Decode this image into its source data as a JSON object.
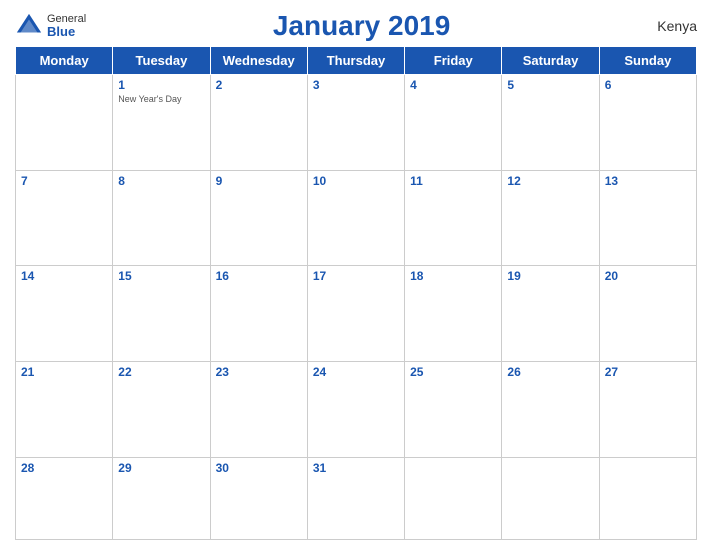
{
  "header": {
    "logo_general": "General",
    "logo_blue": "Blue",
    "title": "January 2019",
    "country": "Kenya"
  },
  "weekdays": [
    "Monday",
    "Tuesday",
    "Wednesday",
    "Thursday",
    "Friday",
    "Saturday",
    "Sunday"
  ],
  "weeks": [
    [
      {
        "day": "",
        "holiday": ""
      },
      {
        "day": "1",
        "holiday": "New Year's Day"
      },
      {
        "day": "2",
        "holiday": ""
      },
      {
        "day": "3",
        "holiday": ""
      },
      {
        "day": "4",
        "holiday": ""
      },
      {
        "day": "5",
        "holiday": ""
      },
      {
        "day": "6",
        "holiday": ""
      }
    ],
    [
      {
        "day": "7",
        "holiday": ""
      },
      {
        "day": "8",
        "holiday": ""
      },
      {
        "day": "9",
        "holiday": ""
      },
      {
        "day": "10",
        "holiday": ""
      },
      {
        "day": "11",
        "holiday": ""
      },
      {
        "day": "12",
        "holiday": ""
      },
      {
        "day": "13",
        "holiday": ""
      }
    ],
    [
      {
        "day": "14",
        "holiday": ""
      },
      {
        "day": "15",
        "holiday": ""
      },
      {
        "day": "16",
        "holiday": ""
      },
      {
        "day": "17",
        "holiday": ""
      },
      {
        "day": "18",
        "holiday": ""
      },
      {
        "day": "19",
        "holiday": ""
      },
      {
        "day": "20",
        "holiday": ""
      }
    ],
    [
      {
        "day": "21",
        "holiday": ""
      },
      {
        "day": "22",
        "holiday": ""
      },
      {
        "day": "23",
        "holiday": ""
      },
      {
        "day": "24",
        "holiday": ""
      },
      {
        "day": "25",
        "holiday": ""
      },
      {
        "day": "26",
        "holiday": ""
      },
      {
        "day": "27",
        "holiday": ""
      }
    ],
    [
      {
        "day": "28",
        "holiday": ""
      },
      {
        "day": "29",
        "holiday": ""
      },
      {
        "day": "30",
        "holiday": ""
      },
      {
        "day": "31",
        "holiday": ""
      },
      {
        "day": "",
        "holiday": ""
      },
      {
        "day": "",
        "holiday": ""
      },
      {
        "day": "",
        "holiday": ""
      }
    ]
  ]
}
